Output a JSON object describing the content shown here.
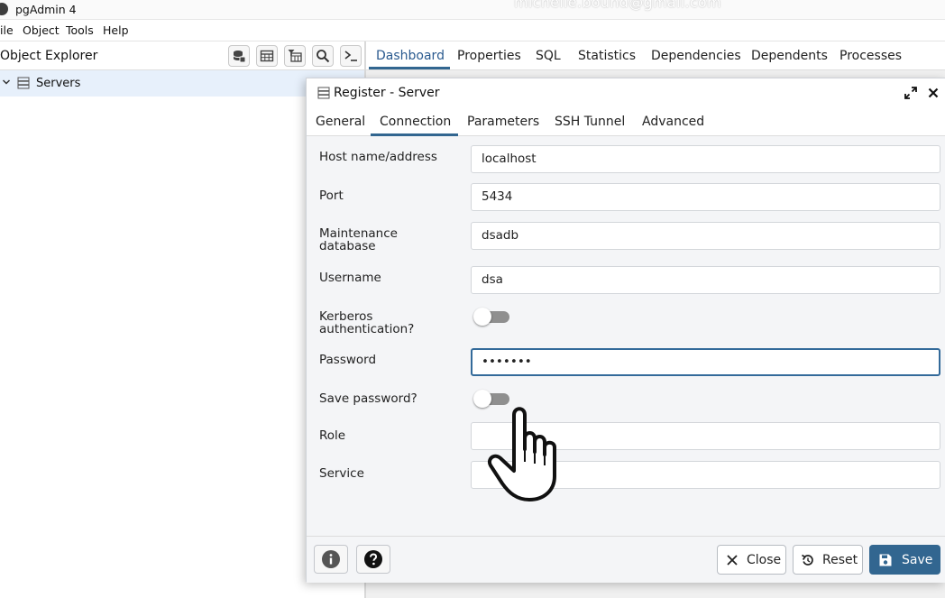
{
  "window": {
    "title": "pgAdmin 4",
    "account": "michelle.bound@gmail.com"
  },
  "menu": {
    "file": "ile",
    "object": "Object",
    "tools": "Tools",
    "help": "Help"
  },
  "explorer": {
    "title": "Object Explorer",
    "servers": "Servers"
  },
  "main_tabs": [
    "Dashboard",
    "Properties",
    "SQL",
    "Statistics",
    "Dependencies",
    "Dependents",
    "Processes"
  ],
  "dialog": {
    "title": "Register - Server",
    "tabs": [
      "General",
      "Connection",
      "Parameters",
      "SSH Tunnel",
      "Advanced"
    ],
    "active_tab": "Connection",
    "fields": {
      "host_label": "Host name/address",
      "host_value": "localhost",
      "port_label": "Port",
      "port_value": "5434",
      "maint_label_1": "Maintenance",
      "maint_label_2": "database",
      "maint_value": "dsadb",
      "username_label": "Username",
      "username_value": "dsa",
      "kerberos_label_1": "Kerberos",
      "kerberos_label_2": "authentication?",
      "kerberos_on": false,
      "password_label": "Password",
      "password_value": "•••••••",
      "save_password_label": "Save password?",
      "save_password_on": false,
      "role_label": "Role",
      "role_value": "",
      "service_label": "Service",
      "service_value": ""
    },
    "footer": {
      "close": "Close",
      "reset": "Reset",
      "save": "Save"
    }
  },
  "colors": {
    "accent": "#326690",
    "selection": "#e7f0fb",
    "toggle_track": "#8f8f8f"
  }
}
